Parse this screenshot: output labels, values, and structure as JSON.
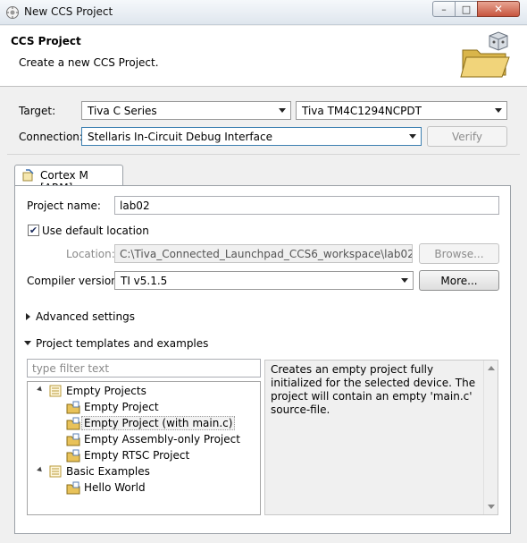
{
  "window": {
    "title": "New CCS Project",
    "minimize_glyph": "–",
    "maximize_glyph": "□",
    "close_glyph": "✕"
  },
  "header": {
    "title": "CCS Project",
    "description": "Create a new CCS Project."
  },
  "target": {
    "label": "Target:",
    "family_value": "Tiva C Series",
    "device_value": "Tiva TM4C1294NCPDT"
  },
  "connection": {
    "label": "Connection:",
    "value": "Stellaris In-Circuit Debug Interface",
    "verify_label": "Verify"
  },
  "tab": {
    "label": "Cortex M [ARM]"
  },
  "project": {
    "name_label": "Project name:",
    "name_value": "lab02",
    "default_location_label": "Use default location",
    "default_location_checked": true,
    "location_label": "Location:",
    "location_value": "C:\\Tiva_Connected_Launchpad_CCS6_workspace\\lab02",
    "browse_label": "Browse...",
    "compiler_label": "Compiler version:",
    "compiler_value": "TI v5.1.5",
    "more_label": "More..."
  },
  "sections": {
    "advanced": "Advanced settings",
    "templates": "Project templates and examples"
  },
  "templates": {
    "filter_placeholder": "type filter text",
    "groups": [
      {
        "label": "Empty Projects",
        "items": [
          "Empty Project",
          "Empty Project (with main.c)",
          "Empty Assembly-only Project",
          "Empty RTSC Project"
        ]
      },
      {
        "label": "Basic Examples",
        "items": [
          "Hello World"
        ]
      }
    ],
    "selected_item": "Empty Project (with main.c)",
    "description": "Creates an empty project fully initialized for the selected device. The project will contain an empty 'main.c' source-file."
  },
  "colors": {
    "selection": "#3399ff",
    "folder": "#e8c25a",
    "close_button": "#c7563f"
  },
  "icons": [
    "eclipse-app-icon",
    "project-wizard-folder-icon",
    "tab-config-icon",
    "folder-icon",
    "project-file-icon"
  ]
}
